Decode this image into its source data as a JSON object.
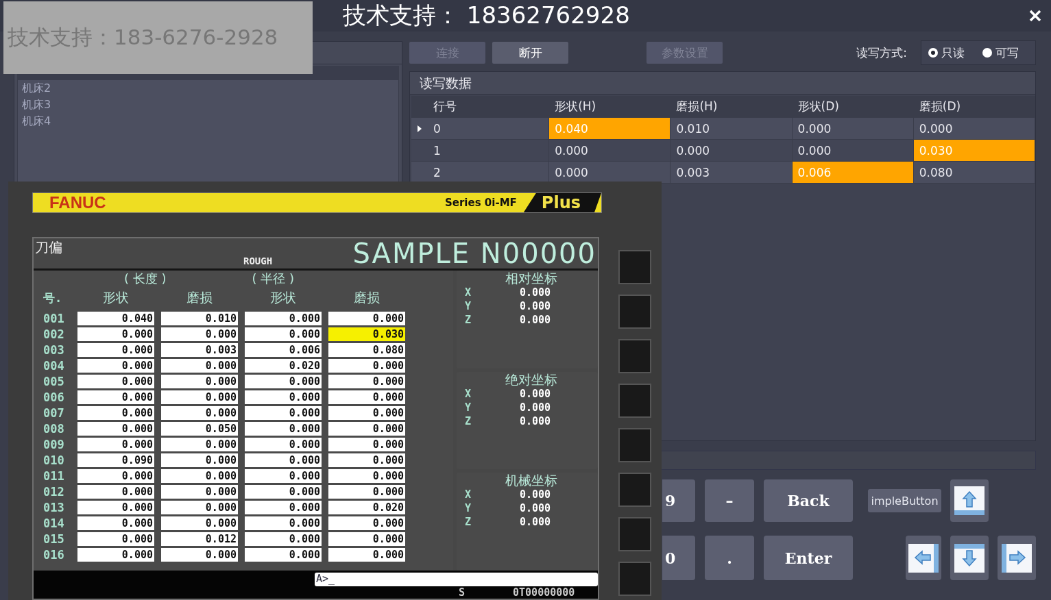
{
  "title": "技术支持： 18362762928",
  "overlay_note": "技术支持：183-6276-2928",
  "machines": [
    {
      "label": "机床2"
    },
    {
      "label": "机床3"
    },
    {
      "label": "机床4"
    }
  ],
  "toolbar": {
    "buttons": [
      {
        "label": "连接",
        "disabled": true
      },
      {
        "label": "断开",
        "disabled": false
      },
      {
        "label": "参数设置",
        "disabled": true
      }
    ],
    "mode_label": "读写方式:",
    "modes": [
      {
        "label": "只读",
        "selected": true
      },
      {
        "label": "可写",
        "selected": false
      }
    ]
  },
  "rw_data": {
    "title": "读写数据",
    "columns": [
      "行号",
      "形状(H)",
      "磨损(H)",
      "形状(D)",
      "磨损(D)"
    ],
    "rows": [
      {
        "current": true,
        "cells": [
          {
            "text": "0",
            "highlighted": false
          },
          {
            "text": "0.040",
            "highlighted": true
          },
          {
            "text": "0.010",
            "highlighted": false
          },
          {
            "text": "0.000",
            "highlighted": false
          },
          {
            "text": "0.000",
            "highlighted": false
          }
        ]
      },
      {
        "current": false,
        "cells": [
          {
            "text": "1",
            "highlighted": false
          },
          {
            "text": "0.000",
            "highlighted": false
          },
          {
            "text": "0.000",
            "highlighted": false
          },
          {
            "text": "0.000",
            "highlighted": false
          },
          {
            "text": "0.030",
            "highlighted": true
          }
        ]
      },
      {
        "current": false,
        "cells": [
          {
            "text": "2",
            "highlighted": false
          },
          {
            "text": "0.000",
            "highlighted": false
          },
          {
            "text": "0.003",
            "highlighted": false
          },
          {
            "text": "0.006",
            "highlighted": true
          },
          {
            "text": "0.080",
            "highlighted": false
          }
        ]
      }
    ]
  },
  "keypad": {
    "keys": [
      {
        "label": "9"
      },
      {
        "label": "–"
      },
      {
        "label": "Back"
      },
      {
        "label": "0"
      },
      {
        "label": "."
      },
      {
        "label": "Enter"
      }
    ],
    "extra_button": "impleButton",
    "arrows": [
      {
        "kind": "up"
      },
      {
        "kind": "left"
      },
      {
        "kind": "down"
      },
      {
        "kind": "right"
      }
    ]
  },
  "fanuc": {
    "brand": "FANUC",
    "series": "Series 0i-MF",
    "plus": "Plus",
    "screen_title": "刀偏",
    "mode": "ROUGH",
    "program": "SAMPLE N00000",
    "group_labels": [
      "( 长度 )",
      "( 半径 )"
    ],
    "columns": [
      "号.",
      "形状",
      "磨损",
      "形状",
      "磨损"
    ],
    "rows": [
      {
        "no": "001",
        "cells": [
          {
            "text": "0.040",
            "selected": false
          },
          {
            "text": "0.010",
            "selected": false
          },
          {
            "text": "0.000",
            "selected": false
          },
          {
            "text": "0.000",
            "selected": false
          }
        ]
      },
      {
        "no": "002",
        "cells": [
          {
            "text": "0.000",
            "selected": false
          },
          {
            "text": "0.000",
            "selected": false
          },
          {
            "text": "0.000",
            "selected": false
          },
          {
            "text": "0.030",
            "selected": true
          }
        ]
      },
      {
        "no": "003",
        "cells": [
          {
            "text": "0.000",
            "selected": false
          },
          {
            "text": "0.003",
            "selected": false
          },
          {
            "text": "0.006",
            "selected": false
          },
          {
            "text": "0.080",
            "selected": false
          }
        ]
      },
      {
        "no": "004",
        "cells": [
          {
            "text": "0.000",
            "selected": false
          },
          {
            "text": "0.000",
            "selected": false
          },
          {
            "text": "0.020",
            "selected": false
          },
          {
            "text": "0.000",
            "selected": false
          }
        ]
      },
      {
        "no": "005",
        "cells": [
          {
            "text": "0.000",
            "selected": false
          },
          {
            "text": "0.000",
            "selected": false
          },
          {
            "text": "0.000",
            "selected": false
          },
          {
            "text": "0.000",
            "selected": false
          }
        ]
      },
      {
        "no": "006",
        "cells": [
          {
            "text": "0.000",
            "selected": false
          },
          {
            "text": "0.000",
            "selected": false
          },
          {
            "text": "0.000",
            "selected": false
          },
          {
            "text": "0.000",
            "selected": false
          }
        ]
      },
      {
        "no": "007",
        "cells": [
          {
            "text": "0.000",
            "selected": false
          },
          {
            "text": "0.000",
            "selected": false
          },
          {
            "text": "0.000",
            "selected": false
          },
          {
            "text": "0.000",
            "selected": false
          }
        ]
      },
      {
        "no": "008",
        "cells": [
          {
            "text": "0.000",
            "selected": false
          },
          {
            "text": "0.050",
            "selected": false
          },
          {
            "text": "0.000",
            "selected": false
          },
          {
            "text": "0.000",
            "selected": false
          }
        ]
      },
      {
        "no": "009",
        "cells": [
          {
            "text": "0.000",
            "selected": false
          },
          {
            "text": "0.000",
            "selected": false
          },
          {
            "text": "0.000",
            "selected": false
          },
          {
            "text": "0.000",
            "selected": false
          }
        ]
      },
      {
        "no": "010",
        "cells": [
          {
            "text": "0.090",
            "selected": false
          },
          {
            "text": "0.000",
            "selected": false
          },
          {
            "text": "0.000",
            "selected": false
          },
          {
            "text": "0.000",
            "selected": false
          }
        ]
      },
      {
        "no": "011",
        "cells": [
          {
            "text": "0.000",
            "selected": false
          },
          {
            "text": "0.000",
            "selected": false
          },
          {
            "text": "0.000",
            "selected": false
          },
          {
            "text": "0.000",
            "selected": false
          }
        ]
      },
      {
        "no": "012",
        "cells": [
          {
            "text": "0.000",
            "selected": false
          },
          {
            "text": "0.000",
            "selected": false
          },
          {
            "text": "0.000",
            "selected": false
          },
          {
            "text": "0.000",
            "selected": false
          }
        ]
      },
      {
        "no": "013",
        "cells": [
          {
            "text": "0.000",
            "selected": false
          },
          {
            "text": "0.000",
            "selected": false
          },
          {
            "text": "0.000",
            "selected": false
          },
          {
            "text": "0.020",
            "selected": false
          }
        ]
      },
      {
        "no": "014",
        "cells": [
          {
            "text": "0.000",
            "selected": false
          },
          {
            "text": "0.000",
            "selected": false
          },
          {
            "text": "0.000",
            "selected": false
          },
          {
            "text": "0.000",
            "selected": false
          }
        ]
      },
      {
        "no": "015",
        "cells": [
          {
            "text": "0.000",
            "selected": false
          },
          {
            "text": "0.012",
            "selected": false
          },
          {
            "text": "0.000",
            "selected": false
          },
          {
            "text": "0.000",
            "selected": false
          }
        ]
      },
      {
        "no": "016",
        "cells": [
          {
            "text": "0.000",
            "selected": false
          },
          {
            "text": "0.000",
            "selected": false
          },
          {
            "text": "0.000",
            "selected": false
          },
          {
            "text": "0.000",
            "selected": false
          }
        ]
      }
    ],
    "coords": [
      {
        "title": "相对坐标",
        "axes": [
          {
            "axis": "X",
            "value": "0.000"
          },
          {
            "axis": "Y",
            "value": "0.000"
          },
          {
            "axis": "Z",
            "value": "0.000"
          }
        ]
      },
      {
        "title": "绝对坐标",
        "axes": [
          {
            "axis": "X",
            "value": "0.000"
          },
          {
            "axis": "Y",
            "value": "0.000"
          },
          {
            "axis": "Z",
            "value": "0.000"
          }
        ]
      },
      {
        "title": "机械坐标",
        "axes": [
          {
            "axis": "X",
            "value": "0.000"
          },
          {
            "axis": "Y",
            "value": "0.000"
          },
          {
            "axis": "Z",
            "value": "0.000"
          }
        ]
      }
    ],
    "input_prompt": "A>_",
    "status": [
      "S",
      "0T00000000"
    ]
  }
}
